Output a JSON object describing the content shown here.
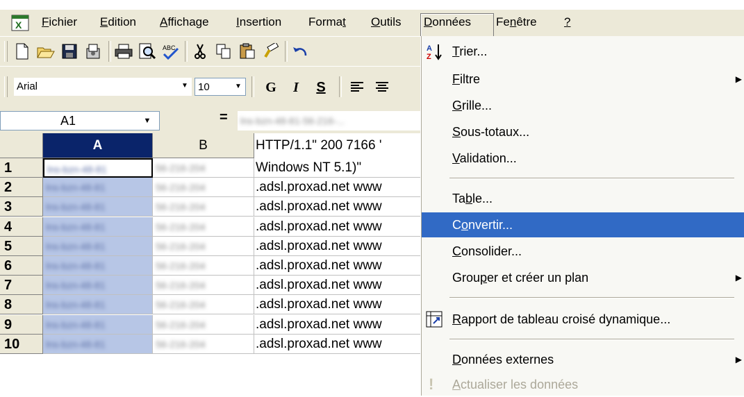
{
  "menubar": {
    "items": [
      "Fichier",
      "Edition",
      "Affichage",
      "Insertion",
      "Format",
      "Outils",
      "Données",
      "Fenêtre",
      "?"
    ]
  },
  "format_toolbar": {
    "font_name": "Arial",
    "font_size": "10",
    "bold_label": "G",
    "italic_label": "I",
    "underline_label": "S"
  },
  "formula_bar": {
    "cell_ref": "A1",
    "equals": "=",
    "formula_text": "lns-bzn-48-81-56-216-..."
  },
  "grid": {
    "columns": [
      "A",
      "B"
    ],
    "c_header_text": "HTTP/1.1\" 200 7166 '",
    "row1_c": "Windows NT 5.1)\"",
    "rows": [
      {
        "num": "1",
        "c": ""
      },
      {
        "num": "2",
        "c": ".adsl.proxad.net www"
      },
      {
        "num": "3",
        "c": ".adsl.proxad.net www"
      },
      {
        "num": "4",
        "c": ".adsl.proxad.net www"
      },
      {
        "num": "5",
        "c": ".adsl.proxad.net www"
      },
      {
        "num": "6",
        "c": ".adsl.proxad.net www"
      },
      {
        "num": "7",
        "c": ".adsl.proxad.net www"
      },
      {
        "num": "8",
        "c": ".adsl.proxad.net www"
      },
      {
        "num": "9",
        "c": ".adsl.proxad.net www"
      },
      {
        "num": "10",
        "c": ".adsl.proxad.net www"
      }
    ],
    "blurred_a": "lns-bzn-48-81",
    "blurred_b": "56-216-204"
  },
  "dropdown": {
    "items": [
      {
        "label": "Trier...",
        "submenu": false
      },
      {
        "label": "Filtre",
        "submenu": true
      },
      {
        "label": "Grille...",
        "submenu": false
      },
      {
        "label": "Sous-totaux...",
        "submenu": false
      },
      {
        "label": "Validation...",
        "submenu": false
      },
      {
        "label": "Table...",
        "submenu": false
      },
      {
        "label": "Convertir...",
        "submenu": false,
        "highlighted": true
      },
      {
        "label": "Consolider...",
        "submenu": false
      },
      {
        "label": "Grouper et créer un plan",
        "submenu": true
      },
      {
        "label": "Rapport de tableau croisé dynamique...",
        "submenu": false
      },
      {
        "label": "Données externes",
        "submenu": true
      },
      {
        "label": "Actualiser les données",
        "submenu": false,
        "disabled": true
      }
    ]
  },
  "colors": {
    "highlight": "#316ac5",
    "chrome": "#ece9d8",
    "selection": "#b7c6e6"
  }
}
